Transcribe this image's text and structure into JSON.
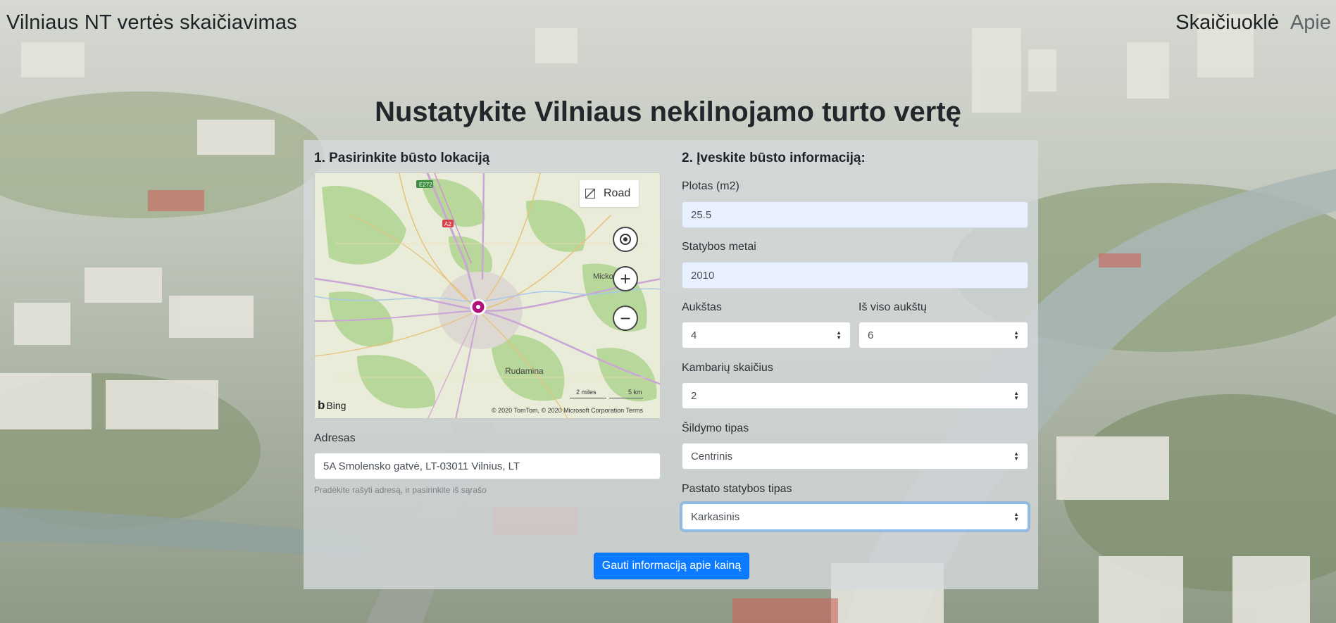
{
  "app": {
    "brand": "Vilniaus NT vertės skaičiavimas",
    "nav": [
      {
        "label": "Skaičiuoklė",
        "active": true
      },
      {
        "label": "Apie",
        "active": false
      }
    ]
  },
  "headline": "Nustatykite Vilniaus nekilnojamo turto vertę",
  "location": {
    "title": "1. Pasirinkite būsto lokaciją",
    "map": {
      "style_button": "Road",
      "labels": {
        "e272": "E272",
        "a2": "A2",
        "micko": "Micko",
        "rudamina": "Rudamina"
      },
      "scale_miles": "2 miles",
      "scale_km": "5 km",
      "attribution": "© 2020 TomTom, © 2020 Microsoft Corporation  Terms",
      "provider": "Bing",
      "controls": {
        "locate": "locate-icon",
        "zoom_in": "+",
        "zoom_out": "−"
      }
    },
    "address_label": "Adresas",
    "address_value": "5A Smolensko gatvė, LT-03011 Vilnius, LT",
    "address_help": "Pradėkite rašyti adresą, ir pasirinkite iš sąrašo"
  },
  "info": {
    "title": "2. Įveskite būsto informaciją:",
    "area_label": "Plotas (m2)",
    "area_value": "25.5",
    "year_label": "Statybos metai",
    "year_value": "2010",
    "floor_label": "Aukštas",
    "floor_value": "4",
    "total_floors_label": "Iš viso aukštų",
    "total_floors_value": "6",
    "rooms_label": "Kambarių skaičius",
    "rooms_value": "2",
    "heating_label": "Šildymo tipas",
    "heating_value": "Centrinis",
    "building_label": "Pastato statybos tipas",
    "building_value": "Karkasinis"
  },
  "submit_label": "Gauti informaciją apie kainą",
  "colors": {
    "primary": "#0d7bff",
    "input_autofill": "#e8f0fe",
    "pin": "#b0147a"
  }
}
